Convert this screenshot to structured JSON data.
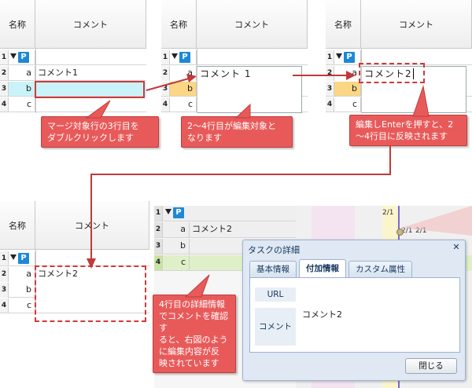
{
  "headers": {
    "name": "名称",
    "comment": "コメント"
  },
  "tag": "P",
  "rows": [
    {
      "num": "1",
      "letter": "",
      "comment": ""
    },
    {
      "num": "2",
      "letter": "a",
      "comment": ""
    },
    {
      "num": "3",
      "letter": "b",
      "comment": ""
    },
    {
      "num": "4",
      "letter": "c",
      "comment": ""
    }
  ],
  "panel1": {
    "row2_comment": "コメント1"
  },
  "panel2": {
    "row2_comment": "コメント 1"
  },
  "panel3": {
    "edit_value": "コメント2"
  },
  "panel4": {
    "row2_comment": "コメント2"
  },
  "panel5": {
    "row2_comment": "コメント2",
    "timeline_labels": [
      "2/1",
      "2/1",
      "2/1"
    ]
  },
  "callouts": {
    "c1": "マージ対象行の3行目を\nダブルクリックします",
    "c2": "2～4行目が編集対象と\nなります",
    "c3": "編集しEnterを押すと、2\n～4行目に反映されます",
    "c4": "4行目の詳細情報\nでコメントを確認す\nると、右図のよう\nに編集内容が反\n映されています"
  },
  "dialog": {
    "title": "タスクの詳細",
    "tabs": [
      "基本情報",
      "付加情報",
      "カスタム属性"
    ],
    "active_tab": 1,
    "fields": {
      "url_label": "URL",
      "comment_label": "コメント",
      "comment_value": "コメント2"
    },
    "close_button": "閉じる"
  },
  "colors": {
    "accent_red": "#e85a5a",
    "tag_blue": "#1e88d6",
    "edit_cyan": "#c9f3f8",
    "highlight_yellow": "#fbd684",
    "row_green": "#dff0c8"
  }
}
